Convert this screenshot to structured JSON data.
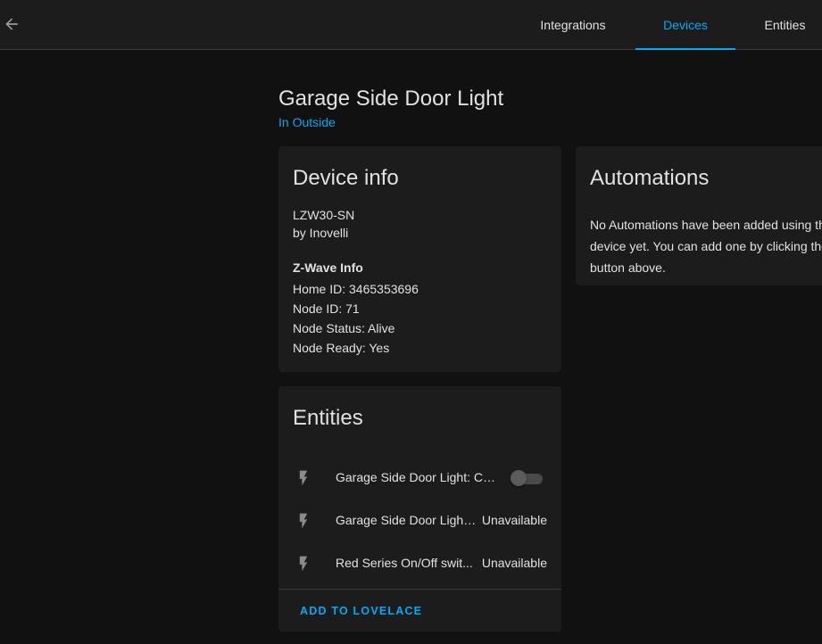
{
  "nav": {
    "back_icon": "arrow-left-icon",
    "tabs": [
      {
        "label": "Integrations",
        "active": false
      },
      {
        "label": "Devices",
        "active": true
      },
      {
        "label": "Entities",
        "active": false
      }
    ]
  },
  "device": {
    "name": "Garage Side Door Light",
    "area": "In Outside"
  },
  "device_info": {
    "title": "Device info",
    "model": "LZW30-SN",
    "manufacturer": "by Inovelli",
    "zwave_heading": "Z-Wave Info",
    "home_id": "Home ID: 3465353696",
    "node_id": "Node ID: 71",
    "node_status": "Node Status: Alive",
    "node_ready": "Node Ready: Yes"
  },
  "entities": {
    "title": "Entities",
    "items": [
      {
        "name": "Garage Side Door Light: Cur...",
        "state": "",
        "icon": "flash-icon",
        "toggle": "off"
      },
      {
        "name": "Garage Side Door Light:...",
        "state": "Unavailable",
        "icon": "flash-icon"
      },
      {
        "name": "Red Series On/Off swit...",
        "state": "Unavailable",
        "icon": "flash-icon"
      }
    ],
    "add_button": "ADD TO LOVELACE"
  },
  "automations": {
    "title": "Automations",
    "text": "No Automations have been added using this device yet. You can add one by clicking the + button above."
  },
  "colors": {
    "accent": "#03a9f4",
    "background": "#111111",
    "card": "#1c1c1c"
  }
}
